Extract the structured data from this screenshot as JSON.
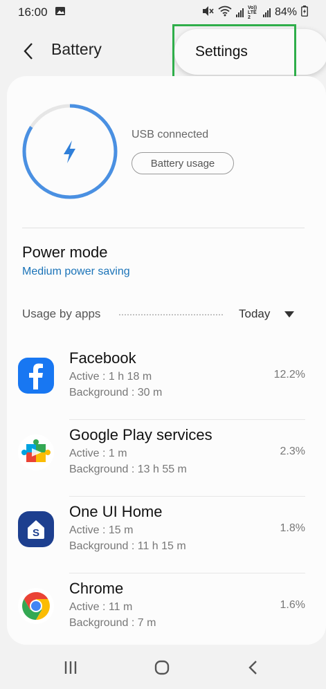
{
  "status_bar": {
    "time": "16:00",
    "battery_percent": "84%",
    "volte_label": "Vo)) LTE2",
    "icons": [
      "image-icon",
      "mute-icon",
      "wifi-icon",
      "signal-icon",
      "signal-icon",
      "battery-charging-icon"
    ]
  },
  "header": {
    "title": "Battery",
    "menu_item": "Settings"
  },
  "battery": {
    "status_text": "USB connected",
    "usage_button": "Battery usage",
    "level": 0.84,
    "ring_color": "#4a90e2",
    "track_color": "#e6e6e6",
    "bolt_color": "#2f7fd9"
  },
  "power_mode": {
    "title": "Power mode",
    "value": "Medium power saving"
  },
  "usage": {
    "label": "Usage by apps",
    "period": "Today"
  },
  "apps": [
    {
      "name": "Facebook",
      "active": "Active : 1 h 18 m",
      "background": "Background : 30 m",
      "percent": "12.2%",
      "icon": "facebook-icon"
    },
    {
      "name": "Google Play services",
      "active": "Active : 1 m",
      "background": "Background : 13 h 55 m",
      "percent": "2.3%",
      "icon": "google-play-services-icon"
    },
    {
      "name": "One UI Home",
      "active": "Active : 15 m",
      "background": "Background : 11 h 15 m",
      "percent": "1.8%",
      "icon": "one-ui-home-icon"
    },
    {
      "name": "Chrome",
      "active": "Active : 11 m",
      "background": "Background : 7 m",
      "percent": "1.6%",
      "icon": "chrome-icon"
    }
  ],
  "colors": {
    "accent_blue": "#1a73b8",
    "highlight_green": "#2fae4a"
  }
}
